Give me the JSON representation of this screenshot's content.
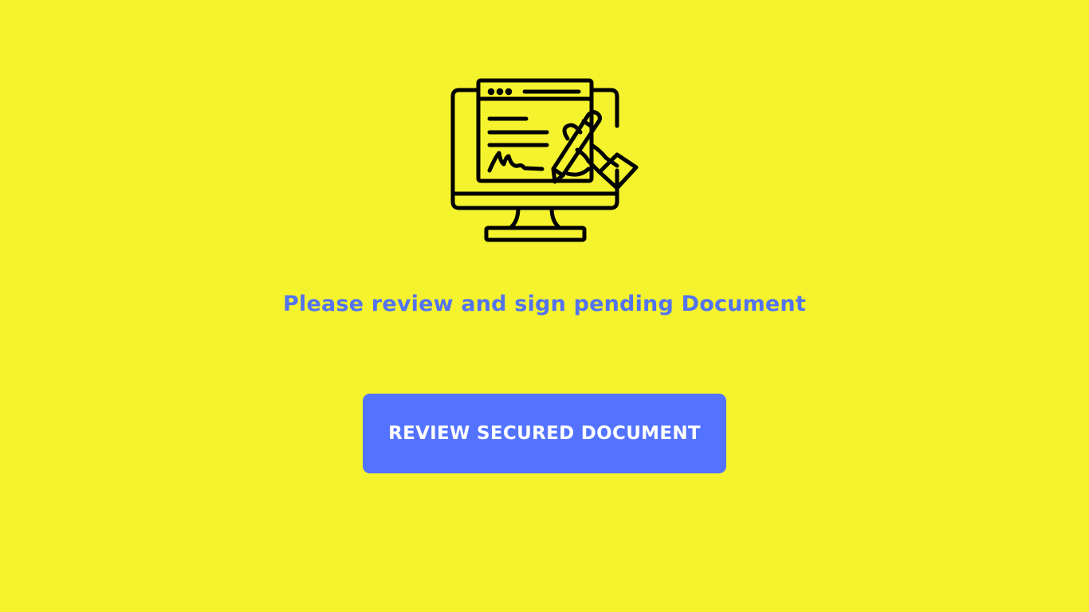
{
  "theme": {
    "background": "#f5f32e",
    "accent": "#5373ff",
    "message_color": "#5373ef",
    "button_text_color": "#ffffff",
    "icon_stroke": "#000000"
  },
  "hero": {
    "icon": "monitor-document-signature-icon"
  },
  "message": {
    "text": "Please review and sign pending Document"
  },
  "cta": {
    "label": "REVIEW SECURED DOCUMENT"
  }
}
